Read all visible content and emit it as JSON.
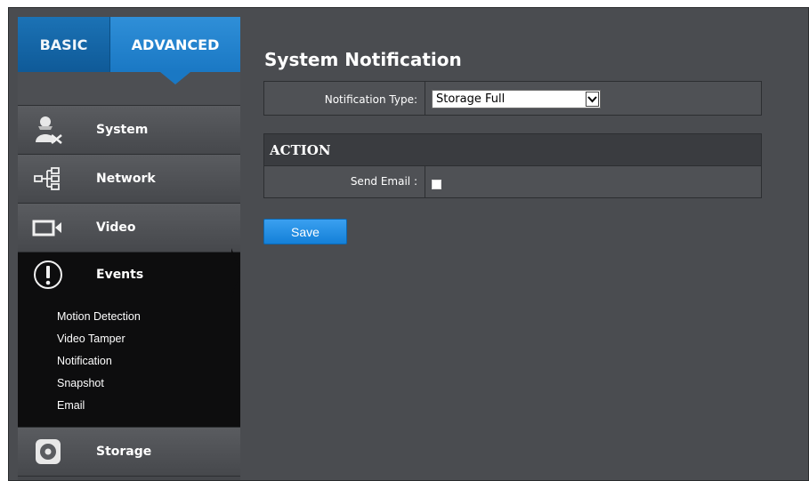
{
  "sidebar": {
    "tabs": {
      "basic": "BASIC",
      "advanced": "ADVANCED"
    },
    "items": {
      "system": "System",
      "network": "Network",
      "video": "Video",
      "events": "Events",
      "storage": "Storage"
    },
    "events_sub": {
      "motion": "Motion Detection",
      "tamper": "Video Tamper",
      "notification": "Notification",
      "snapshot": "Snapshot",
      "email": "Email"
    },
    "icons": [
      "user-gear-icon",
      "network-tree-icon",
      "camera-icon",
      "exclamation-icon",
      "storage-disk-icon"
    ]
  },
  "main": {
    "title": "System Notification",
    "notification_type": {
      "label": "Notification Type:",
      "value": "Storage Full"
    },
    "action": {
      "header": "ACTION",
      "send_email_label": "Send Email :",
      "send_email_checked": false
    },
    "save_label": "Save"
  },
  "colors": {
    "accent": "#1a78c4",
    "background": "#4a4c50",
    "active_nav": "#0d0d0e"
  }
}
